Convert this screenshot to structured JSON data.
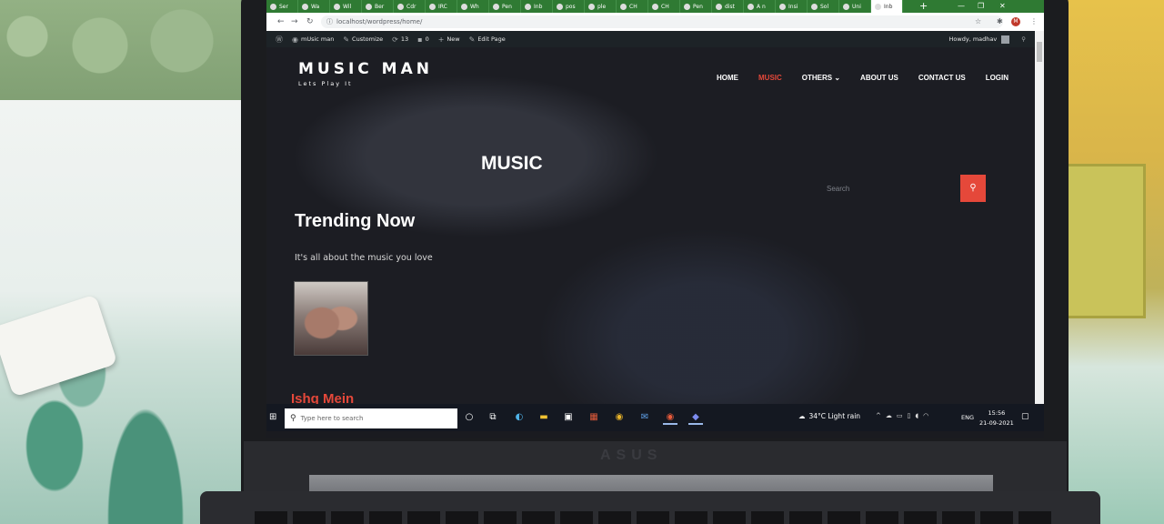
{
  "browser": {
    "tabs": [
      "Ser",
      "Wa",
      "Wil",
      "Ber",
      "Cdr",
      "IRC",
      "Wh",
      "Pen",
      "Inb",
      "pos",
      "ple",
      "CH",
      "CH",
      "Pen",
      "dist",
      "A n",
      "Insi",
      "Sol",
      "Uni",
      "Inb"
    ],
    "new_tab": "+",
    "url": "localhost/wordpress/home/",
    "profile_initial": "M",
    "icons": {
      "back": "back-arrow-icon",
      "forward": "forward-arrow-icon",
      "reload": "reload-icon",
      "info": "info-icon",
      "star": "star-icon",
      "extensions": "puzzle-icon",
      "menu": "kebab-menu-icon"
    }
  },
  "wp_admin_bar": {
    "site_name": "mUsic man",
    "customize": "Customize",
    "updates": "13",
    "comments": "0",
    "new": "New",
    "edit": "Edit Page",
    "greeting": "Howdy, madhav"
  },
  "site": {
    "title": "MUSIC MAN",
    "tagline": "Lets Play It",
    "nav": [
      "HOME",
      "MUSIC",
      "OTHERS ⌄",
      "ABOUT US",
      "CONTACT US",
      "LOGIN"
    ],
    "active_nav": "MUSIC",
    "accent": "#e5483a"
  },
  "page": {
    "title": "MUSIC",
    "search_placeholder": "Search",
    "section_title": "Trending Now",
    "section_subtitle": "It's all about the music you love",
    "song_title": "Ishq Mein"
  },
  "taskbar": {
    "search_placeholder": "Type here to search",
    "weather": "34°C  Light rain",
    "language": "ENG",
    "time": "15:56",
    "date": "21-09-2021"
  },
  "laptop_brand": "ASUS"
}
